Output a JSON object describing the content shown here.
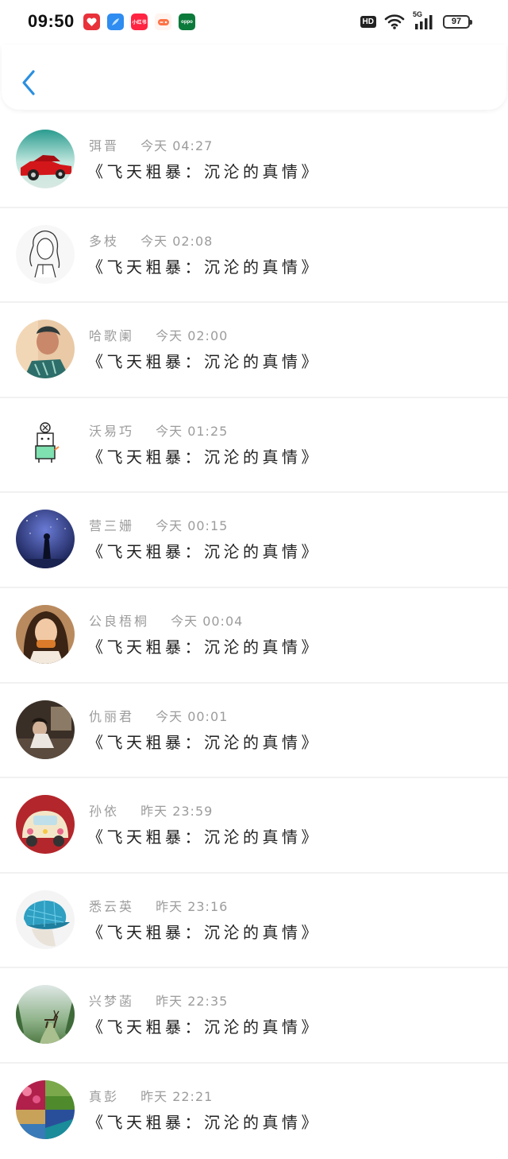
{
  "status_bar": {
    "time": "09:50",
    "hd": "HD",
    "network": "5G",
    "battery": "97",
    "apps": [
      {
        "icon": "red-heart-app-icon",
        "color": "#e8313a",
        "label": ""
      },
      {
        "icon": "blue-feather-app-icon",
        "color": "#2f8cf0",
        "label": ""
      },
      {
        "icon": "xiaohongshu-app-icon",
        "color": "#ff2442",
        "label": "小红书"
      },
      {
        "icon": "game-center-app-icon",
        "color": "#ff7043",
        "label": ""
      },
      {
        "icon": "oppo-app-icon",
        "color": "#0b7a3a",
        "label": "oppo"
      }
    ]
  },
  "header": {
    "back_icon": "chevron-left-icon",
    "accent": "#2a8fe0"
  },
  "items": [
    {
      "name": "弭晋",
      "when": "今天 04:27",
      "title": "《飞天粗暴：沉沦的真情》",
      "avatar": "red-sports-car"
    },
    {
      "name": "多枝",
      "when": "今天 02:08",
      "title": "《飞天粗暴：沉沦的真情》",
      "avatar": "girl-sketch"
    },
    {
      "name": "哈歌阑",
      "when": "今天 02:00",
      "title": "《飞天粗暴：沉沦的真情》",
      "avatar": "woman-portrait"
    },
    {
      "name": "沃易巧",
      "when": "今天 01:25",
      "title": "《飞天粗暴：沉沦的真情》",
      "avatar": "cartoon-robot"
    },
    {
      "name": "营三姗",
      "when": "今天 00:15",
      "title": "《飞天粗暴：沉沦的真情》",
      "avatar": "starry-night"
    },
    {
      "name": "公良梧桐",
      "when": "今天 00:04",
      "title": "《飞天粗暴：沉沦的真情》",
      "avatar": "girl-eating"
    },
    {
      "name": "仇丽君",
      "when": "今天 00:01",
      "title": "《飞天粗暴：沉沦的真情》",
      "avatar": "dark-room"
    },
    {
      "name": "孙依",
      "when": "昨天 23:59",
      "title": "《飞天粗暴：沉沦的真情》",
      "avatar": "beetle-car"
    },
    {
      "name": "悉云英",
      "when": "昨天 23:16",
      "title": "《飞天粗暴：沉沦的真情》",
      "avatar": "plaid-hat"
    },
    {
      "name": "兴梦菡",
      "when": "昨天 22:35",
      "title": "《飞天粗暴：沉沦的真情》",
      "avatar": "deer-forest"
    },
    {
      "name": "真彭",
      "when": "昨天 22:21",
      "title": "《飞天粗暴：沉沦的真情》",
      "avatar": "photo-collage"
    }
  ]
}
